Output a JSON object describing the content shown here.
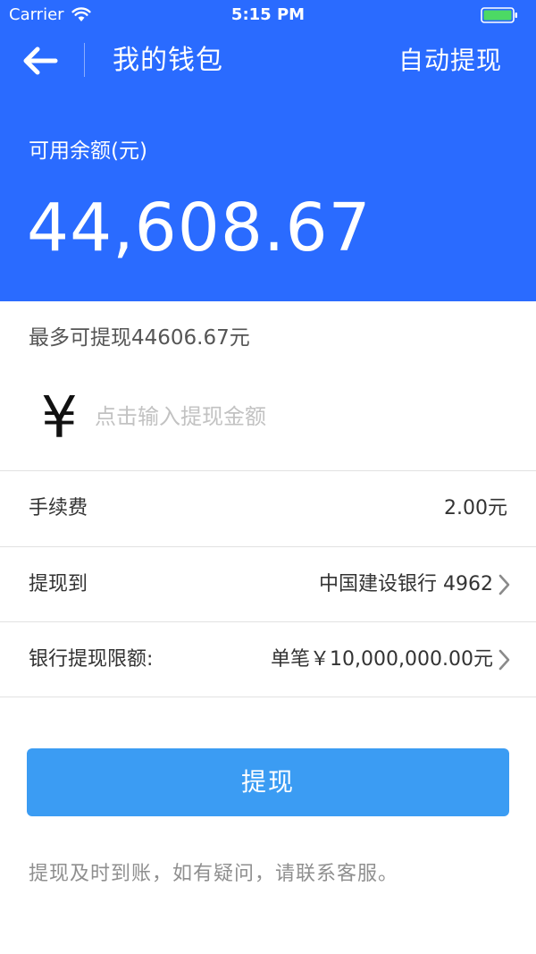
{
  "status_bar": {
    "carrier": "Carrier",
    "time": "5:15 PM",
    "wifi_icon": "wifi-icon",
    "battery_icon": "battery-full-icon"
  },
  "nav": {
    "back_icon": "arrow-left-icon",
    "title": "我的钱包",
    "auto_withdraw_label": "自动提现"
  },
  "balance": {
    "label": "可用余额(元)",
    "amount": "44,608.67"
  },
  "withdraw": {
    "max_text": "最多可提现44606.67元",
    "currency_symbol": "¥",
    "amount_placeholder": "点击输入提现金额",
    "amount_value": ""
  },
  "rows": [
    {
      "label": "手续费",
      "value": "2.00元",
      "chevron": false
    },
    {
      "label": "提现到",
      "value": "中国建设银行 4962",
      "chevron": true
    },
    {
      "label": "银行提现限额:",
      "value": "单笔￥10,000,000.00元",
      "chevron": true
    }
  ],
  "submit_label": "提现",
  "footer_note": "提现及时到账，如有疑问，请联系客服。",
  "colors": {
    "header_bg": "#2a6bff",
    "button_bg": "#3b9cf3",
    "divider": "#e2e2e2",
    "placeholder": "#c2c2c2",
    "battery": "#4cd964"
  }
}
